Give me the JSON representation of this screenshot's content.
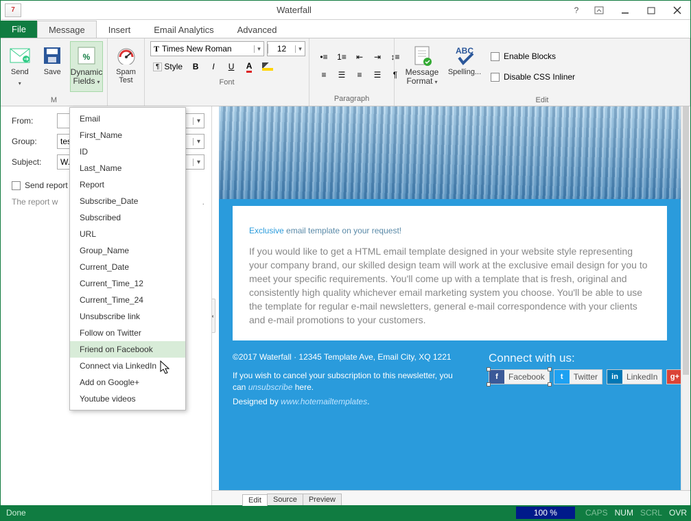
{
  "title": "Waterfall",
  "app_icon_text": "7",
  "tabs": {
    "file": "File",
    "message": "Message",
    "insert": "Insert",
    "analytics": "Email Analytics",
    "advanced": "Advanced"
  },
  "ribbon": {
    "send": "Send",
    "save": "Save",
    "dynamic_fields": "Dynamic Fields",
    "spam_test": "Spam Test",
    "group_m": "M",
    "style_label": "Style",
    "font_family": "Times New Roman",
    "font_size": "12",
    "group_font": "Font",
    "group_paragraph": "Paragraph",
    "message_format": "Message Format",
    "spelling": "Spelling...",
    "enable_blocks": "Enable Blocks",
    "disable_css": "Disable CSS Inliner",
    "group_edit": "Edit"
  },
  "dropdown": {
    "items": [
      "Email",
      "First_Name",
      "ID",
      "Last_Name",
      "Report",
      "Subscribe_Date",
      "Subscribed",
      "URL",
      "Group_Name",
      "Current_Date",
      "Current_Time_12",
      "Current_Time_24",
      "Unsubscribe link",
      "Follow on Twitter",
      "Friend on Facebook",
      "Connect via LinkedIn",
      "Add on Google+",
      "Youtube videos"
    ],
    "hover_index": 14
  },
  "form": {
    "from_label": "From:",
    "from_value": "",
    "group_label": "Group:",
    "group_value": "tes",
    "subject_label": "Subject:",
    "subject_value": "W.",
    "send_report": "Send report",
    "hint_prefix": "The report w",
    "hint_suffix": "."
  },
  "preview": {
    "heading_accent": "Exclusive",
    "heading_rest": " email template on your request!",
    "body": "If you would like to get a HTML email template designed in your website style representing your company brand, our skilled design team will work at the exclusive email design for you to meet your specific requirements. You'll come up with a template that is fresh, original and consistently high quality whichever email marketing system you choose. You'll be able to use the template for regular e-mail newsletters, general e-mail correspondence with your clients and e-mail promotions to your customers.",
    "footer_copyright": "©2017 Waterfall · 12345 Template Ave, Email City, XQ 1221",
    "footer_cancel_pre": "If you wish to cancel your subscription to this newsletter, you can ",
    "footer_unsub": "unsubscribe",
    "footer_cancel_post": " here.",
    "footer_design_pre": "Designed by ",
    "footer_design_link": "www.hotemailtemplates",
    "footer_design_post": ".",
    "connect_label": "Connect with us:",
    "social": {
      "fb": "Facebook",
      "tw": "Twitter",
      "li": "LinkedIn",
      "gp": "Google+"
    }
  },
  "bottom_tabs": {
    "edit": "Edit",
    "source": "Source",
    "preview": "Preview"
  },
  "status": {
    "done": "Done",
    "zoom": "100 %",
    "caps": "CAPS",
    "num": "NUM",
    "scrl": "SCRL",
    "ovr": "OVR"
  }
}
